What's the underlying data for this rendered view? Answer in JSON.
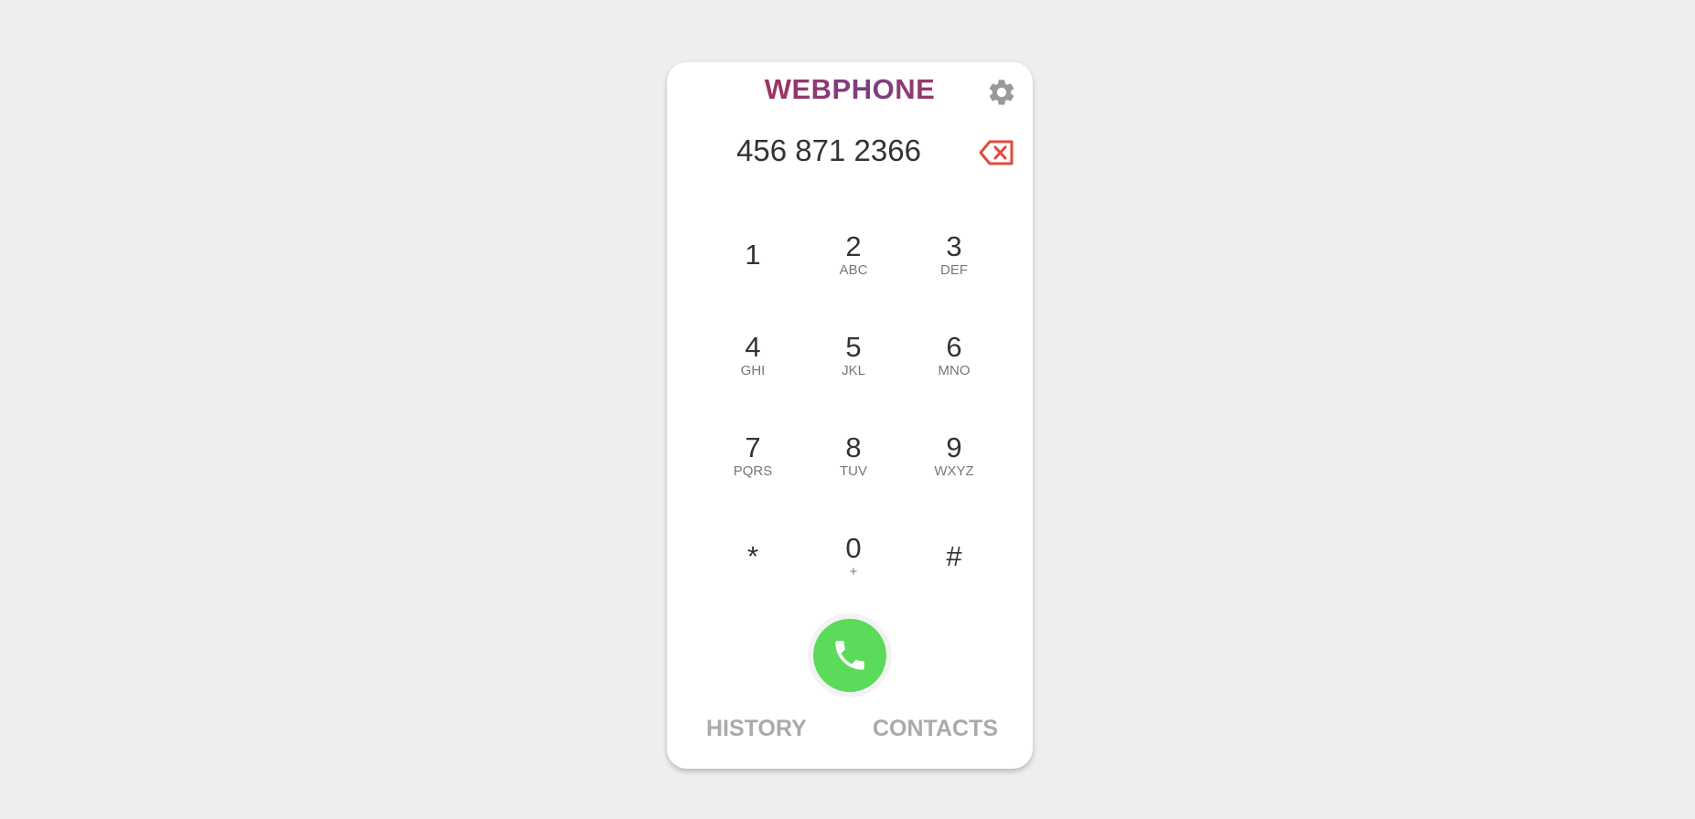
{
  "app": {
    "title": "WEBPHONE"
  },
  "dialer": {
    "number": "456 871 2366"
  },
  "keypad": {
    "keys": [
      {
        "digit": "1",
        "letters": ""
      },
      {
        "digit": "2",
        "letters": "ABC"
      },
      {
        "digit": "3",
        "letters": "DEF"
      },
      {
        "digit": "4",
        "letters": "GHI"
      },
      {
        "digit": "5",
        "letters": "JKL"
      },
      {
        "digit": "6",
        "letters": "MNO"
      },
      {
        "digit": "7",
        "letters": "PQRS"
      },
      {
        "digit": "8",
        "letters": "TUV"
      },
      {
        "digit": "9",
        "letters": "WXYZ"
      },
      {
        "digit": "*",
        "letters": ""
      },
      {
        "digit": "0",
        "letters": "+"
      },
      {
        "digit": "#",
        "letters": ""
      }
    ]
  },
  "nav": {
    "history_label": "HISTORY",
    "contacts_label": "CONTACTS"
  },
  "icons": {
    "settings": "gear-icon",
    "backspace": "backspace-icon",
    "call": "phone-icon"
  },
  "colors": {
    "background": "#eeeeee",
    "card": "#ffffff",
    "title_start": "#c1274a",
    "title_mid": "#7a3f80",
    "title_end": "#cc2944",
    "call_button": "#5adb5a",
    "backspace": "#e24a3b",
    "gear": "#999999",
    "tab_text": "#aaaaaa"
  }
}
